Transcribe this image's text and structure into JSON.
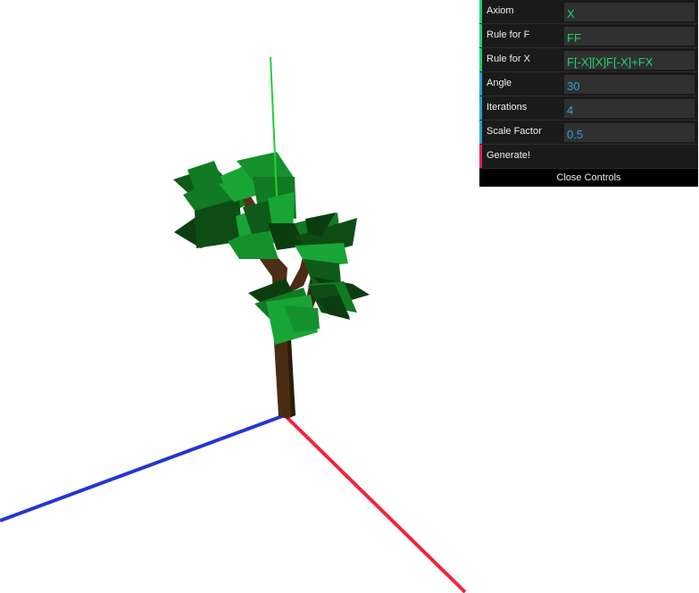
{
  "scene": {
    "axis_colors": {
      "x": "#f0243e",
      "y": "#1ed22e",
      "z": "#2537cf"
    },
    "trunk_color": "#4a2c14",
    "leaf_colors": [
      "#0d4d14",
      "#117a22",
      "#18a535",
      "#0c3d10"
    ]
  },
  "controls": {
    "axiom": {
      "label": "Axiom",
      "value": "X"
    },
    "rule_f": {
      "label": "Rule for F",
      "value": "FF"
    },
    "rule_x": {
      "label": "Rule for X",
      "value": "F[-X][X]F[-X]+FX"
    },
    "angle": {
      "label": "Angle",
      "value": "30"
    },
    "iterations": {
      "label": "Iterations",
      "value": "4"
    },
    "scale_factor": {
      "label": "Scale Factor",
      "value": "0.5"
    },
    "generate": {
      "label": "Generate!"
    },
    "close_label": "Close Controls"
  }
}
